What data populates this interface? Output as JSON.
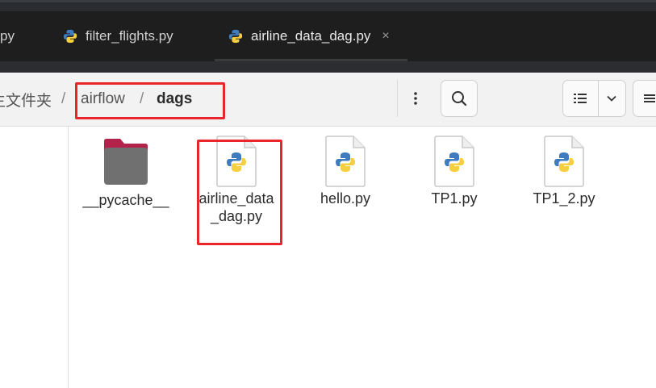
{
  "editor": {
    "tabs": [
      {
        "label": "py",
        "active": false
      },
      {
        "label": "filter_flights.py",
        "active": false
      },
      {
        "label": "airline_data_dag.py",
        "active": true,
        "close": "×"
      }
    ]
  },
  "file_manager": {
    "breadcrumb": [
      {
        "label": "主文件夹"
      },
      {
        "label": "airflow"
      },
      {
        "label": "dags",
        "current": true
      }
    ],
    "separator": "/",
    "toolbar": {
      "menu_icon": "more-vertical-icon",
      "search_icon": "search-icon",
      "view_icon": "list-view-icon",
      "view_options_icon": "chevron-down-icon",
      "app_menu_icon": "hamburger-menu-icon"
    },
    "files": [
      {
        "name": "__pycache__",
        "type": "folder"
      },
      {
        "name": "airline_data_dag.py",
        "type": "python",
        "highlighted": true
      },
      {
        "name": "hello.py",
        "type": "python"
      },
      {
        "name": "TP1.py",
        "type": "python"
      },
      {
        "name": "TP1_2.py",
        "type": "python"
      }
    ]
  },
  "colors": {
    "highlight": "#e8262b",
    "editor_bg": "#1e1e1e",
    "python_blue": "#3f7cbf",
    "python_yellow": "#f5cf3f"
  }
}
